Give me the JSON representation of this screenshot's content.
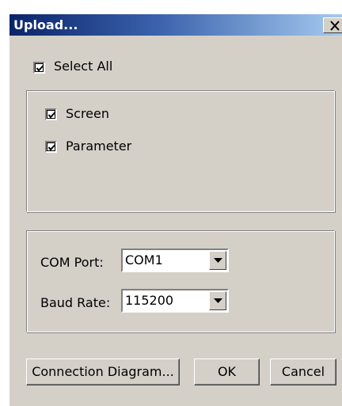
{
  "window": {
    "title": "Upload...",
    "close_glyph": "close-icon"
  },
  "select_all": {
    "label": "Select All",
    "checked": true
  },
  "items": [
    {
      "label": "Screen",
      "checked": true
    },
    {
      "label": "Parameter",
      "checked": true
    }
  ],
  "com_port": {
    "label": "COM Port:",
    "value": "COM1"
  },
  "baud_rate": {
    "label": "Baud Rate:",
    "value": "115200"
  },
  "buttons": {
    "connection_diagram": "Connection Diagram...",
    "ok": "OK",
    "cancel": "Cancel"
  },
  "colors": {
    "face": "#d4d0c8",
    "title_start": "#0a246a",
    "title_end": "#a6caf0"
  }
}
